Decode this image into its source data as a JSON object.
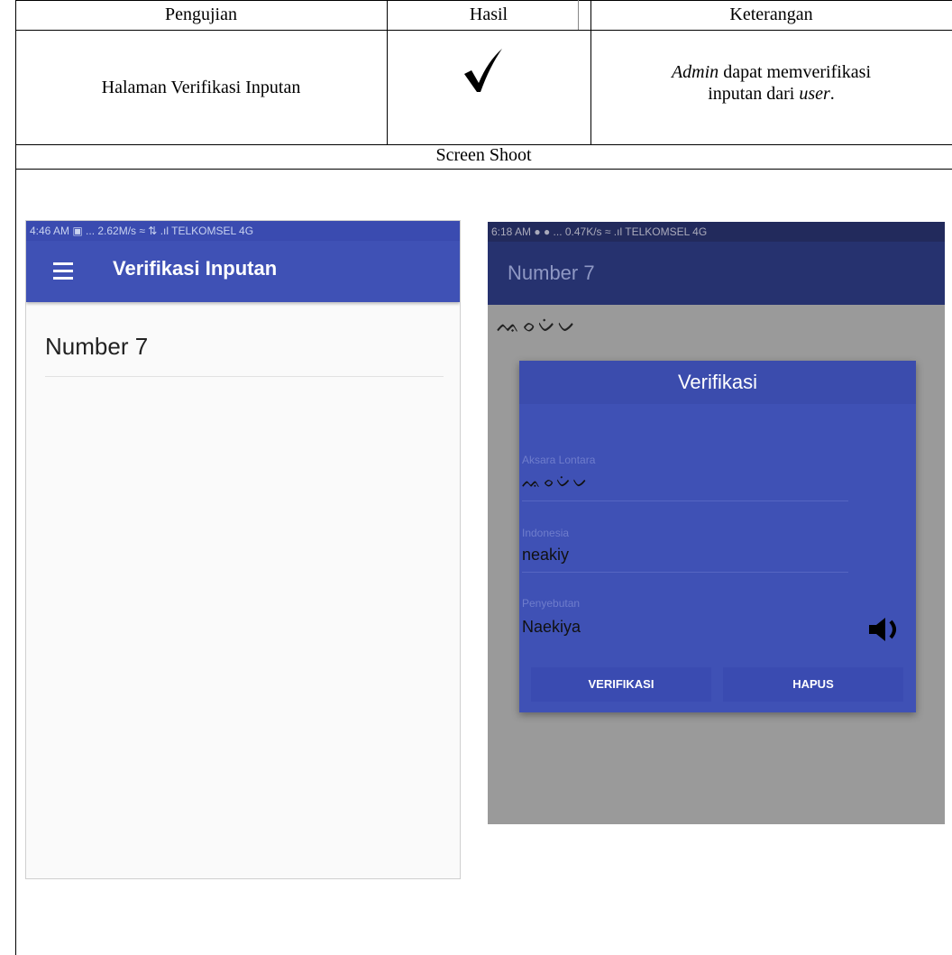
{
  "table": {
    "headers": {
      "col1": "Pengujian",
      "col2": "Hasil",
      "col3": "Keterangan"
    },
    "row": {
      "pengujian": "Halaman Verifikasi Inputan",
      "keterangan_part1_italic": "Admin",
      "keterangan_part2": " dapat memverifikasi",
      "keterangan_part3": "inputan dari ",
      "keterangan_part4_italic": "user",
      "keterangan_part5": "."
    },
    "screenshot_header": "Screen Shoot"
  },
  "phone1": {
    "status_text": "4:46 AM ▣ ... 2.62M/s ≈ ⇅ .ıl TELKOMSEL 4G",
    "title": "Verifikasi Inputan",
    "list_item": "Number 7",
    "colors": {
      "appbar": "#3f51b5",
      "status": "#3a4bb0",
      "background": "#fafafa"
    }
  },
  "phone2": {
    "status_text": "6:18 AM ● ● ... 0.47K/s ≈ .ıl TELKOMSEL 4G",
    "title": "Number 7",
    "script_text": "ᨕᨔᨆᨗᨆ",
    "dialog": {
      "title": "Verifikasi",
      "field1_label": "Aksara Lontara",
      "field1_value": "ᨕᨔᨆᨗᨆ",
      "field2_label": "Indonesia",
      "field2_value": "neakiy",
      "field3_label": "Penyebutan",
      "field3_value": "Naekiya",
      "verify_button": "VERIFIKASI",
      "delete_button": "HAPUS"
    },
    "colors": {
      "dim_bg": "#9a9a9a",
      "dialog": "#3f51b5",
      "appbar": "#26326f"
    }
  }
}
